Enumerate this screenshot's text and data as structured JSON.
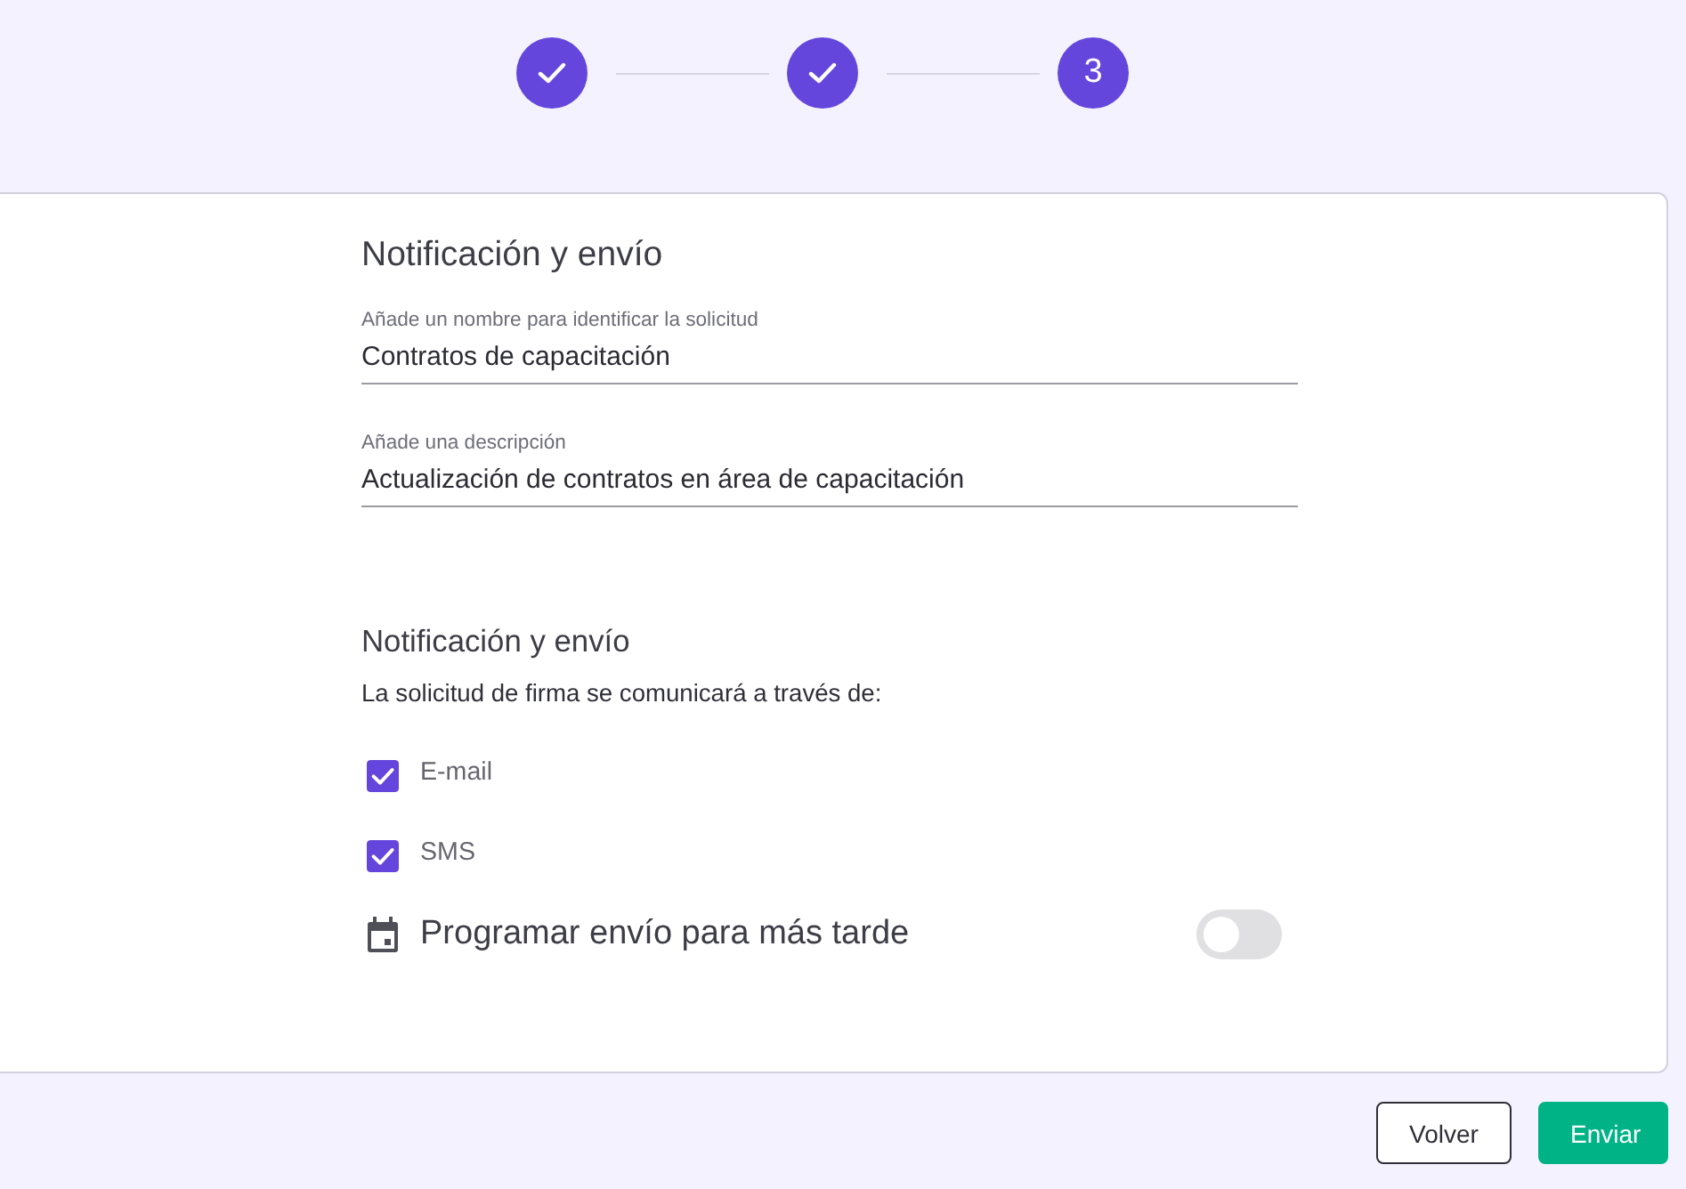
{
  "stepper": {
    "steps": [
      {
        "completed": true
      },
      {
        "completed": true
      },
      {
        "completed": false,
        "label": "3"
      }
    ]
  },
  "sections": [
    {
      "title": "Notificación y envío",
      "fields": [
        {
          "label": "Añade un nombre para identificar la solicitud",
          "value": "Contratos de capacitación"
        },
        {
          "label": "Añade una descripción",
          "value": "Actualización de contratos en área de capacitación"
        }
      ]
    },
    {
      "title": "Notificación y envío",
      "description": "La solicitud de firma se comunicará a través de:",
      "channels": [
        {
          "label": "E-mail",
          "checked": true
        },
        {
          "label": "SMS",
          "checked": true
        }
      ],
      "schedule": {
        "label": "Programar envío para más tarde",
        "on": false
      }
    }
  ],
  "actions": [
    {
      "label": "Volver",
      "kind": "secondary"
    },
    {
      "label": "Enviar",
      "kind": "primary"
    }
  ]
}
